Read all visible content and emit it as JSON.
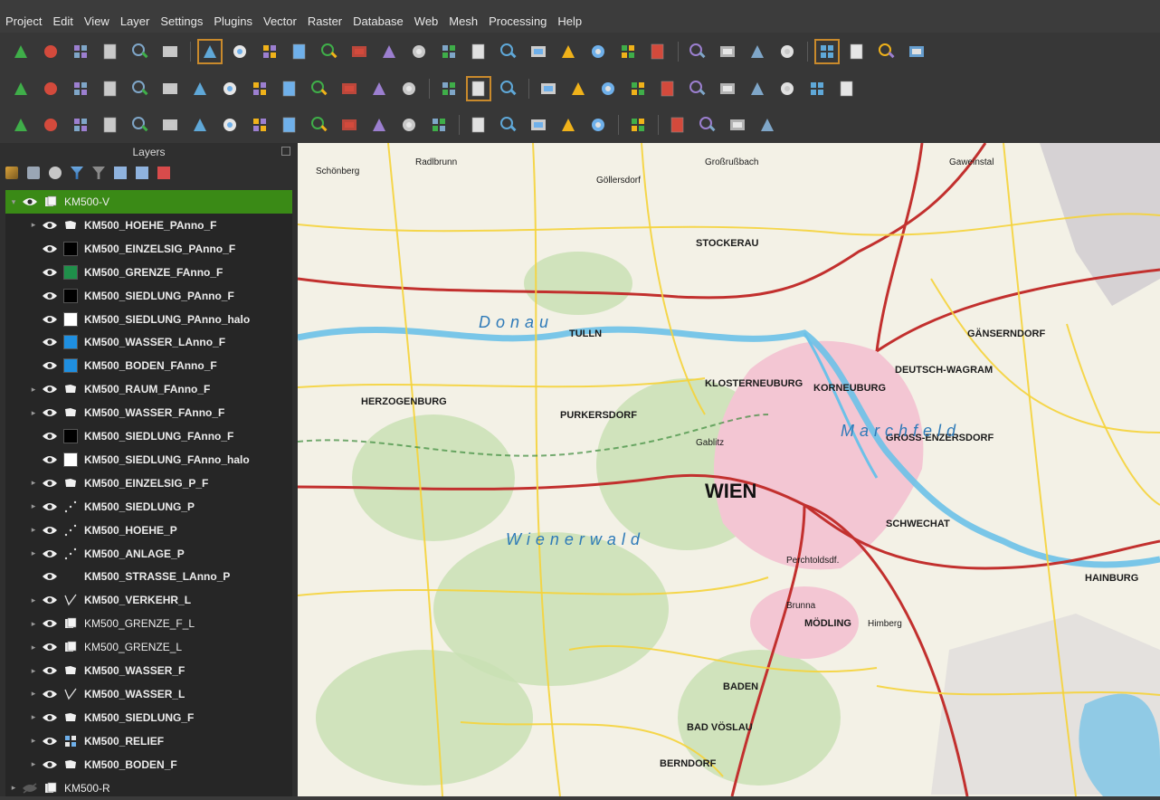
{
  "menubar": {
    "items": [
      "Project",
      "Edit",
      "View",
      "Layer",
      "Settings",
      "Plugins",
      "Vector",
      "Raster",
      "Database",
      "Web",
      "Mesh",
      "Processing",
      "Help"
    ]
  },
  "toolbars": {
    "row1": [
      "new-project-icon",
      "open-project-icon",
      "save-project-icon",
      "print-layout-icon",
      "layout-manager-icon",
      "style-manager-icon",
      "pan-map-icon",
      "pan-to-selection-icon",
      "zoom-in-icon",
      "zoom-out-icon",
      "zoom-full-icon",
      "zoom-to-selection-icon",
      "zoom-to-layer-icon",
      "zoom-native-icon",
      "zoom-last-icon",
      "zoom-next-icon",
      "new-map-view-icon",
      "new-3d-view-icon",
      "bookmark-icon",
      "show-bookmarks-icon",
      "temporal-controller-icon",
      "refresh-icon",
      "identify-icon",
      "attribute-table-icon",
      "select-features-icon",
      "statistics-icon",
      "field-calculator-icon",
      "measure-icon",
      "annotation-icon",
      "settings-gear-icon"
    ],
    "row2": [
      "digitize-point-icon",
      "add-raster-icon",
      "add-mesh-icon",
      "add-delimited-text-icon",
      "add-vector-icon",
      "add-virtual-layer-icon",
      "add-wms-icon",
      "add-wfs-icon",
      "add-wcs-icon",
      "add-xyz-icon",
      "new-shapefile-icon",
      "new-temp-layer-icon",
      "remove-layer-icon",
      "layer-properties-icon",
      "globe-search-icon",
      "globe-zoom-icon",
      "binoculars-icon",
      "edit-pencil-icon",
      "save-edits-icon",
      "add-feature-icon",
      "vertex-tool-icon",
      "delete-selected-icon",
      "cut-features-icon",
      "copy-features-icon",
      "paste-features-icon",
      "undo-icon",
      "redo-icon",
      "merge-icon"
    ],
    "row3": [
      "snapping-icon",
      "add-ring-icon",
      "fill-ring-icon",
      "add-part-icon",
      "delete-ring-icon",
      "delete-part-icon",
      "reshape-icon",
      "offset-curve-icon",
      "split-features-icon",
      "split-parts-icon",
      "merge-features-icon",
      "rotate-point-icon",
      "simplify-icon",
      "trace-icon",
      "grid-icon",
      "python-icon",
      "pick-icon",
      "georeferencer-icon",
      "qgis-cloud-icon",
      "qgis-cloud-2-icon",
      "share-icon",
      "label-icon",
      "edit-labels-icon",
      "pin-labels-icon",
      "label-toolbar-icon"
    ]
  },
  "layers_panel": {
    "title": "Layers",
    "tree": [
      {
        "label": "KM500-V",
        "level": 0,
        "visible": true,
        "group": true,
        "selected": true,
        "symbol": "group-icon",
        "bold": false
      },
      {
        "label": "KM500_HOEHE_PAnno_F",
        "level": 1,
        "visible": true,
        "symbol": "polygon-sym-icon",
        "bold": true,
        "expander": true
      },
      {
        "label": "KM500_EINZELSIG_PAnno_F",
        "level": 1,
        "visible": true,
        "symbol": "fill",
        "color": "#000000",
        "bold": true
      },
      {
        "label": "KM500_GRENZE_FAnno_F",
        "level": 1,
        "visible": true,
        "symbol": "fill",
        "color": "#1f8f4a",
        "bold": true
      },
      {
        "label": "KM500_SIEDLUNG_PAnno_F",
        "level": 1,
        "visible": true,
        "symbol": "fill",
        "color": "#000000",
        "bold": true
      },
      {
        "label": "KM500_SIEDLUNG_PAnno_halo",
        "level": 1,
        "visible": true,
        "symbol": "fill",
        "color": "#ffffff",
        "bold": true
      },
      {
        "label": "KM500_WASSER_LAnno_F",
        "level": 1,
        "visible": true,
        "symbol": "fill",
        "color": "#1f8fe0",
        "bold": true
      },
      {
        "label": "KM500_BODEN_FAnno_F",
        "level": 1,
        "visible": true,
        "symbol": "fill",
        "color": "#1f8fe0",
        "bold": true
      },
      {
        "label": "KM500_RAUM_FAnno_F",
        "level": 1,
        "visible": true,
        "symbol": "polygon-sym-icon",
        "bold": true,
        "expander": true
      },
      {
        "label": "KM500_WASSER_FAnno_F",
        "level": 1,
        "visible": true,
        "symbol": "polygon-sym-icon",
        "bold": true,
        "expander": true
      },
      {
        "label": "KM500_SIEDLUNG_FAnno_F",
        "level": 1,
        "visible": true,
        "symbol": "fill",
        "color": "#000000",
        "bold": true
      },
      {
        "label": "KM500_SIEDLUNG_FAnno_halo",
        "level": 1,
        "visible": true,
        "symbol": "fill",
        "color": "#ffffff",
        "bold": true
      },
      {
        "label": "KM500_EINZELSIG_P_F",
        "level": 1,
        "visible": true,
        "symbol": "polygon-sym-icon",
        "bold": true,
        "expander": true
      },
      {
        "label": "KM500_SIEDLUNG_P",
        "level": 1,
        "visible": true,
        "symbol": "point-sym-icon",
        "bold": true,
        "expander": true
      },
      {
        "label": "KM500_HOEHE_P",
        "level": 1,
        "visible": true,
        "symbol": "point-sym-icon",
        "bold": true,
        "expander": true
      },
      {
        "label": "KM500_ANLAGE_P",
        "level": 1,
        "visible": true,
        "symbol": "point-sym-icon",
        "bold": true,
        "expander": true
      },
      {
        "label": "KM500_STRASSE_LAnno_P",
        "level": 1,
        "visible": true,
        "symbol": "none",
        "bold": true
      },
      {
        "label": "KM500_VERKEHR_L",
        "level": 1,
        "visible": true,
        "symbol": "line-sym-icon",
        "bold": true,
        "expander": true
      },
      {
        "label": "KM500_GRENZE_F_L",
        "level": 1,
        "visible": true,
        "symbol": "group-icon",
        "bold": false,
        "expander": true
      },
      {
        "label": "KM500_GRENZE_L",
        "level": 1,
        "visible": true,
        "symbol": "group-icon",
        "bold": false,
        "expander": true
      },
      {
        "label": "KM500_WASSER_F",
        "level": 1,
        "visible": true,
        "symbol": "polygon-sym-icon",
        "bold": true,
        "expander": true
      },
      {
        "label": "KM500_WASSER_L",
        "level": 1,
        "visible": true,
        "symbol": "line-sym-icon",
        "bold": true,
        "expander": true
      },
      {
        "label": "KM500_SIEDLUNG_F",
        "level": 1,
        "visible": true,
        "symbol": "polygon-sym-icon",
        "bold": true,
        "expander": true
      },
      {
        "label": "KM500_RELIEF",
        "level": 1,
        "visible": true,
        "symbol": "raster-sym-icon",
        "bold": true,
        "expander": true
      },
      {
        "label": "KM500_BODEN_F",
        "level": 1,
        "visible": true,
        "symbol": "polygon-sym-icon",
        "bold": true,
        "expander": true
      },
      {
        "label": "KM500-R",
        "level": 0,
        "visible": false,
        "group": true,
        "symbol": "group-icon",
        "bold": false,
        "expander": true
      }
    ]
  },
  "map": {
    "big_label": "WIEN",
    "labels": [
      "Schönberg",
      "Radlbrunn",
      "Göllersdorf",
      "Großrußbach",
      "Gaweinstal",
      "STOCKERAU",
      "KORNEUBURG",
      "GÄNSERNDORF",
      "TULLN",
      "KLOSTERNEUBURG",
      "DEUTSCH-WAGRAM",
      "HERZOGENBURG",
      "PURKERSDORF",
      "Gablitz",
      "GROSS-ENZERSDORF",
      "SCHWECHAT",
      "Perchtoldsdf.",
      "Brunna",
      "MÖDLING",
      "BADEN",
      "BAD VÖSLAU",
      "BERNDORF",
      "HAINBURG",
      "Himberg",
      "Donau",
      "Marchfeld",
      "Wienerwald"
    ],
    "colors": {
      "urban": "#f3c6d3",
      "water": "#6cc1e8",
      "forest": "#c9e0b4",
      "motorway": "#c2302e",
      "road": "#f5d33a",
      "base": "#f3f1e6"
    }
  }
}
